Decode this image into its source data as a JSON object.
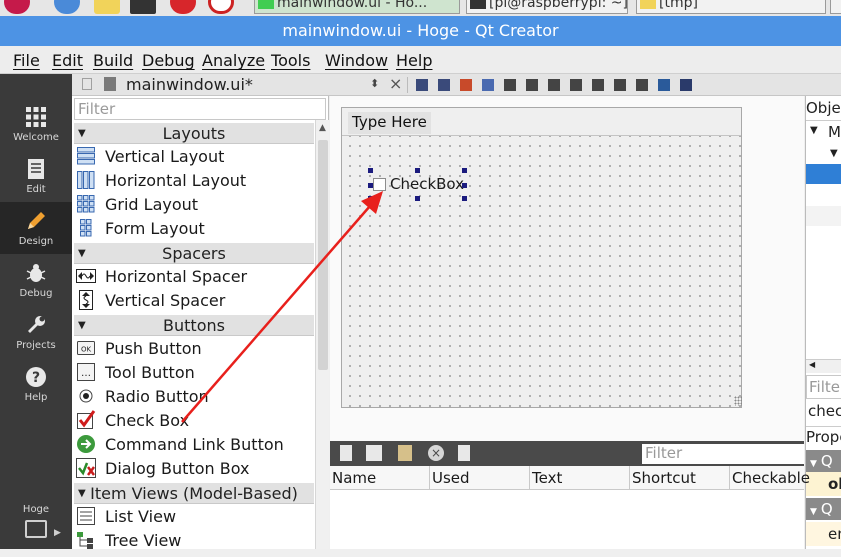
{
  "taskbar": {
    "tasks": [
      "mainwindow.ui - Ho...",
      "[pi@raspberrypi: ~]",
      "[tmp]"
    ]
  },
  "window": {
    "title": "mainwindow.ui - Hoge - Qt Creator"
  },
  "menubar": {
    "items": [
      "File",
      "Edit",
      "Build",
      "Debug",
      "Analyze",
      "Tools",
      "Window",
      "Help"
    ]
  },
  "modes": [
    {
      "label": "Welcome",
      "icon": "grid-icon"
    },
    {
      "label": "Edit",
      "icon": "document-icon"
    },
    {
      "label": "Design",
      "icon": "pencil-icon"
    },
    {
      "label": "Debug",
      "icon": "bug-icon"
    },
    {
      "label": "Projects",
      "icon": "wrench-icon"
    },
    {
      "label": "Help",
      "icon": "question-icon"
    }
  ],
  "project": {
    "name": "Hoge"
  },
  "editor": {
    "file": "mainwindow.ui*"
  },
  "widgetbox": {
    "filter_placeholder": "Filter",
    "categories": {
      "layouts": "Layouts",
      "spacers": "Spacers",
      "buttons": "Buttons",
      "itemviews": "Item Views (Model-Based)"
    },
    "items": {
      "vertical_layout": "Vertical Layout",
      "horizontal_layout": "Horizontal Layout",
      "grid_layout": "Grid Layout",
      "form_layout": "Form Layout",
      "horizontal_spacer": "Horizontal Spacer",
      "vertical_spacer": "Vertical Spacer",
      "push_button": "Push Button",
      "tool_button": "Tool Button",
      "radio_button": "Radio Button",
      "check_box": "Check Box",
      "command_link_button": "Command Link Button",
      "dialog_button_box": "Dialog Button Box",
      "list_view": "List View",
      "tree_view": "Tree View"
    }
  },
  "form": {
    "menu_placeholder": "Type Here",
    "checkbox_label": "CheckBox"
  },
  "actioneditor": {
    "filter_placeholder": "Filter",
    "columns": [
      "Name",
      "Used",
      "Text",
      "Shortcut",
      "Checkable"
    ]
  },
  "objectinspector": {
    "header": "Objec",
    "row_m": "M",
    "filter_text": "Filter",
    "filter_value": "chec",
    "props_header": "Prope",
    "q1": "Q",
    "prop_obj": "ob",
    "q2": "Q",
    "prop_en": "en"
  },
  "colors": {
    "titlebar": "#4d93e4",
    "modebar": "#3a3a3a",
    "arrow": "#e8201c",
    "selection": "#2f7fd6"
  }
}
